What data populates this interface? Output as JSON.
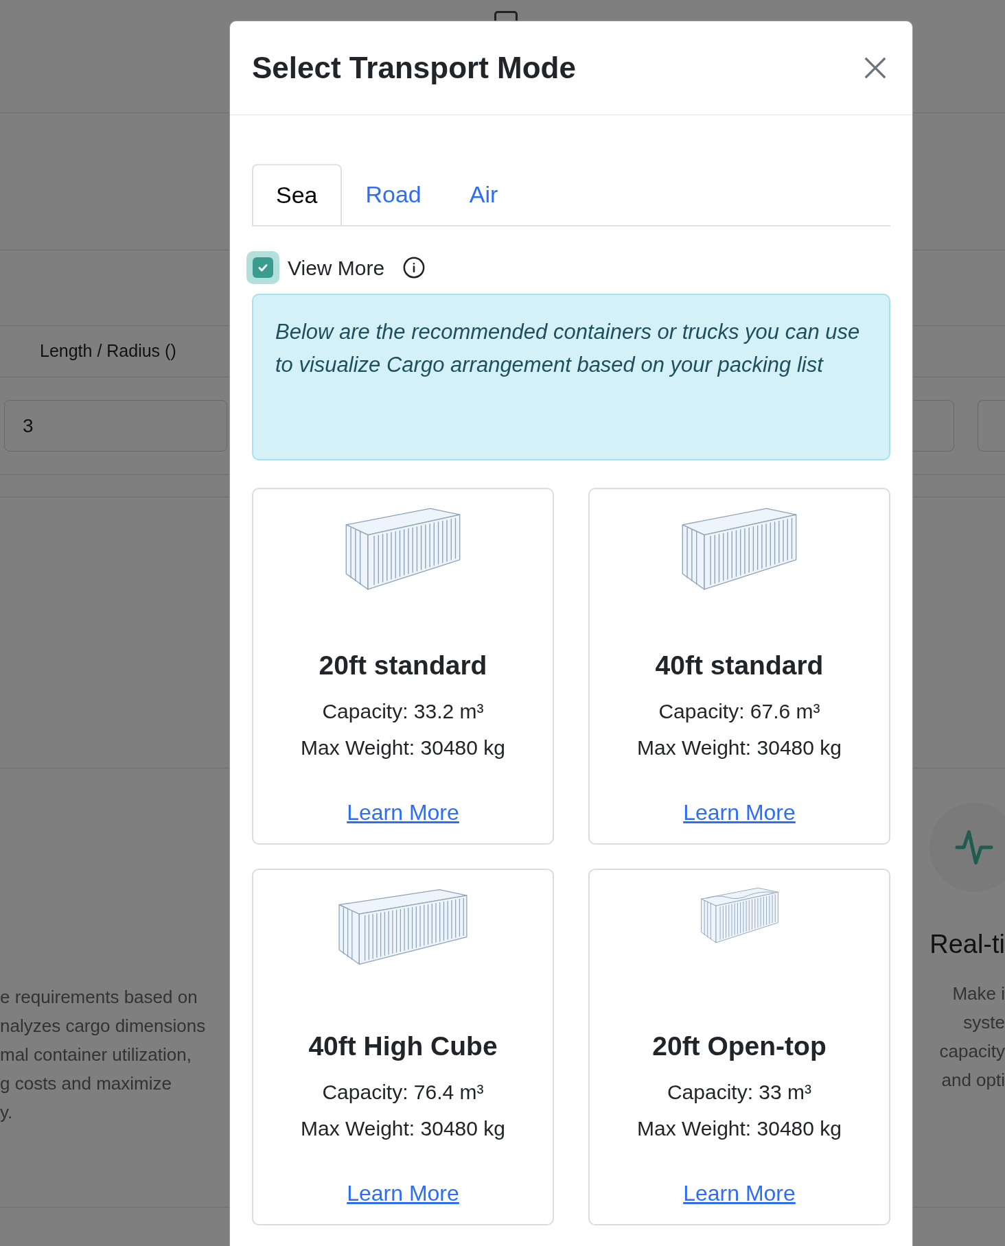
{
  "background": {
    "column_header": "Length / Radius ()",
    "input_value": "3",
    "feature_left_lines": [
      "e requirements based on",
      "nalyzes cargo dimensions",
      "mal container utilization,",
      "g costs and maximize",
      "y."
    ],
    "feature_right": {
      "title": "Real-ti",
      "lines": [
        "Make i",
        "syste",
        "capacity",
        "and opti"
      ]
    }
  },
  "modal": {
    "title": "Select Transport Mode",
    "tabs": [
      {
        "label": "Sea",
        "selected": true
      },
      {
        "label": "Road",
        "selected": false
      },
      {
        "label": "Air",
        "selected": false
      }
    ],
    "view_more": {
      "label": "View More",
      "checked": true
    },
    "alert": "Below are the recommended containers or trucks you can use to visualize Cargo arrangement based on your packing list",
    "cards": [
      {
        "kind": "standard",
        "name": "20ft standard",
        "capacity": "Capacity: 33.2 m³",
        "max_weight": "Max Weight: 30480 kg",
        "link": "Learn More"
      },
      {
        "kind": "standard",
        "name": "40ft standard",
        "capacity": "Capacity: 67.6 m³",
        "max_weight": "Max Weight: 30480 kg",
        "link": "Learn More"
      },
      {
        "kind": "long",
        "name": "40ft High Cube",
        "capacity": "Capacity: 76.4 m³",
        "max_weight": "Max Weight: 30480 kg",
        "link": "Learn More"
      },
      {
        "kind": "open-top",
        "name": "20ft Open-top",
        "capacity": "Capacity: 33 m³",
        "max_weight": "Max Weight: 30480 kg",
        "link": "Learn More"
      }
    ]
  }
}
